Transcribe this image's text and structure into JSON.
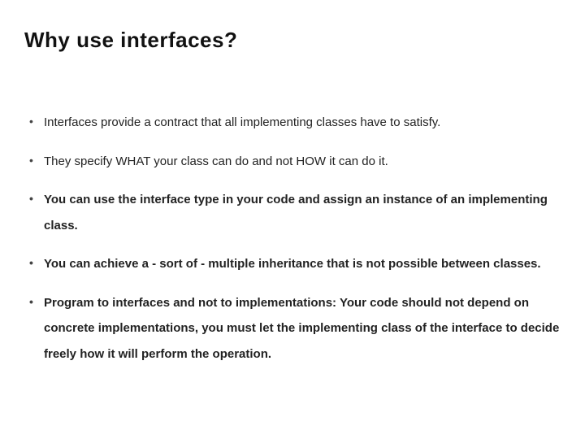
{
  "title": "Why use interfaces?",
  "bullets": {
    "b0": "Interfaces provide a contract that all implementing classes have to satisfy.",
    "b1": "They specify WHAT your class can do and not HOW it can do it.",
    "b2": "You can use the interface type in your code and assign an instance of an implementing class.",
    "b3_pre": "You can achieve a - sort of - ",
    "b3_bold": "multiple inheritance",
    "b3_post": " that is not possible between classes.",
    "b4_lead": "Program to interfaces and not to implementations:",
    "b4_rest": " Your code should not depend on concrete implementations, you must let the implementing class of the interface to decide freely how it will perform the operation."
  }
}
